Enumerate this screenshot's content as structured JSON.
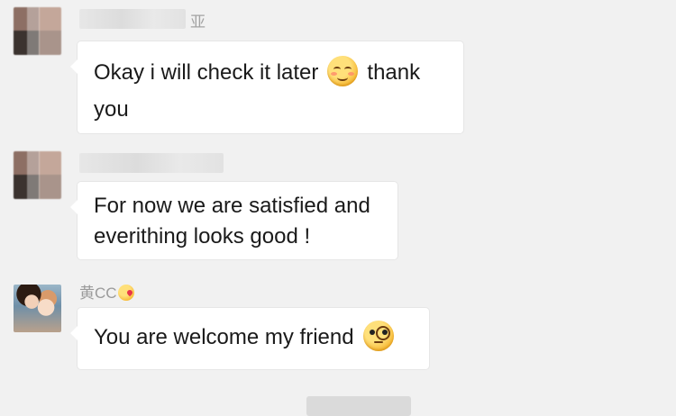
{
  "messages": [
    {
      "sender": "亚",
      "sender_redacted": true,
      "avatar": "blurred-avatar",
      "text_before_emoji": "Okay i will check it later",
      "emoji": "smiling-blush-emoji",
      "text_after_emoji": "thank",
      "text_line2": "you"
    },
    {
      "sender": "",
      "sender_redacted": true,
      "avatar": "blurred-avatar",
      "text_line1": "For now we are satisfied and",
      "text_line2": "everithing looks good !"
    },
    {
      "sender": "黄CC",
      "sender_emoji": "kissing-heart-emoji",
      "avatar": "photo-avatar",
      "text": "You are welcome my friend",
      "emoji": "monocle-face-emoji"
    }
  ],
  "timestamp": "",
  "colors": {
    "background": "#f1f1f1",
    "bubble": "#ffffff",
    "sender_name": "#9a9a9a"
  }
}
